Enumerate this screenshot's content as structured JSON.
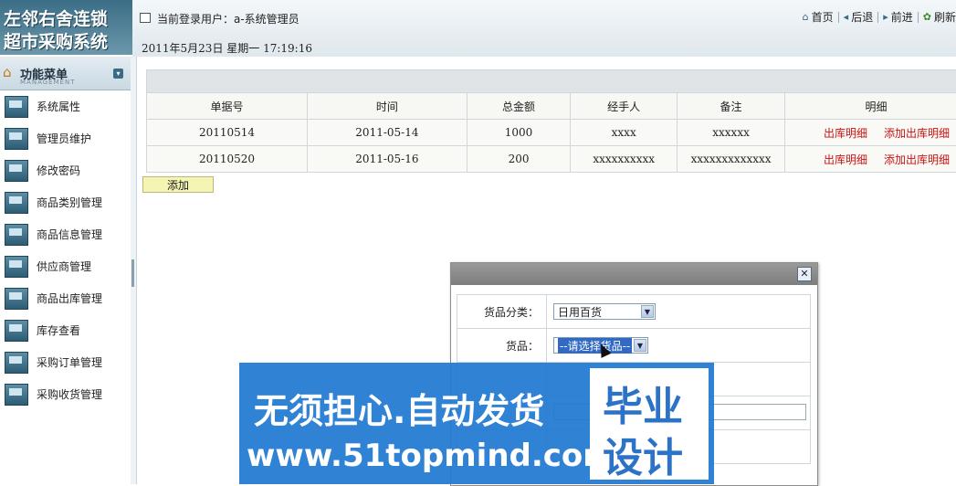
{
  "app": {
    "logo_line1": "左邻右舍连锁",
    "logo_line2": "超市采购系统"
  },
  "header": {
    "current_user": "当前登录用户：a-系统管理员",
    "date": "2011年5月23日  星期一   17:19:16",
    "nav": {
      "home": "首页",
      "back": "后退",
      "forward": "前进",
      "refresh": "刷新"
    }
  },
  "sidebar": {
    "title": "功能菜单",
    "subtitle": "MANAGEMENT",
    "items": [
      {
        "label": "系统属性"
      },
      {
        "label": "管理员维护"
      },
      {
        "label": "修改密码"
      },
      {
        "label": "商品类别管理"
      },
      {
        "label": "商品信息管理"
      },
      {
        "label": "供应商管理"
      },
      {
        "label": "商品出库管理"
      },
      {
        "label": "库存查看"
      },
      {
        "label": "采购订单管理"
      },
      {
        "label": "采购收货管理"
      }
    ]
  },
  "table": {
    "columns": [
      "单据号",
      "时间",
      "总金额",
      "经手人",
      "备注",
      "明细"
    ],
    "rows": [
      {
        "id": "20110514",
        "time": "2011-05-14",
        "amount": "1000",
        "handler": "xxxx",
        "note": "xxxxxx",
        "link1": "出库明细",
        "link2": "添加出库明细"
      },
      {
        "id": "20110520",
        "time": "2011-05-16",
        "amount": "200",
        "handler": "xxxxxxxxxx",
        "note": "xxxxxxxxxxxxx",
        "link1": "出库明细",
        "link2": "添加出库明细"
      }
    ],
    "add_button": "添加"
  },
  "dialog": {
    "close": "✕",
    "category_label": "货品分类：",
    "category_value": "日用百货",
    "goods_label": "货品：",
    "goods_value": "--请选择货品--"
  },
  "watermark": {
    "line1": "无须担心.自动发货",
    "line2": "www.51topmind.com",
    "box1": "毕业",
    "box2": "设计"
  },
  "colors": {
    "link_red": "#cc1111",
    "add_button_bg": "#f4f4b3",
    "watermark_blue": "#2078d2"
  }
}
